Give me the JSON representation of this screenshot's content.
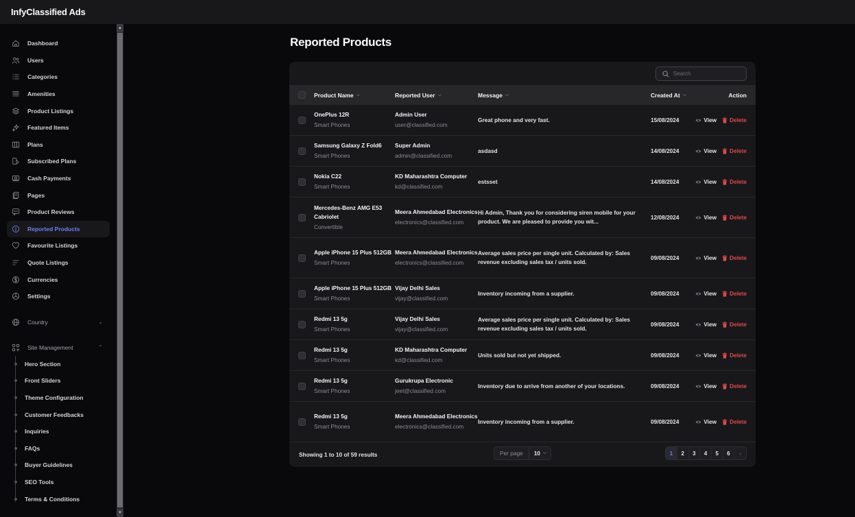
{
  "app": {
    "title": "InfyClassified Ads"
  },
  "sidebar": {
    "items": [
      {
        "label": "Dashboard",
        "icon": "home-icon"
      },
      {
        "label": "Users",
        "icon": "users-icon"
      },
      {
        "label": "Categories",
        "icon": "list-icon"
      },
      {
        "label": "Amenities",
        "icon": "lines-icon"
      },
      {
        "label": "Product Listings",
        "icon": "layers-icon"
      },
      {
        "label": "Featured Items",
        "icon": "sparkles-icon"
      },
      {
        "label": "Plans",
        "icon": "columns-icon"
      },
      {
        "label": "Subscribed Plans",
        "icon": "subscription-icon"
      },
      {
        "label": "Cash Payments",
        "icon": "cash-icon"
      },
      {
        "label": "Pages",
        "icon": "pages-icon"
      },
      {
        "label": "Product Reviews",
        "icon": "chat-icon"
      },
      {
        "label": "Reported Products",
        "icon": "alert-circle-icon",
        "active": true
      },
      {
        "label": "Favourite Listings",
        "icon": "heart-icon"
      },
      {
        "label": "Quote Listings",
        "icon": "quote-lines-icon"
      },
      {
        "label": "Currencies",
        "icon": "dollar-circle-icon"
      },
      {
        "label": "Settings",
        "icon": "settings-icon"
      }
    ],
    "groups": [
      {
        "label": "Country",
        "icon": "globe-icon",
        "expanded": false
      },
      {
        "label": "Site Management",
        "icon": "grid-plus-icon",
        "expanded": true
      }
    ],
    "site_management": [
      "Hero Section",
      "Front Sliders",
      "Theme Configuration",
      "Customer Feedbacks",
      "Inquiries",
      "FAQs",
      "Buyer Guidelines",
      "SEO Tools",
      "Terms & Conditions"
    ]
  },
  "page": {
    "title": "Reported Products",
    "search": {
      "placeholder": "Search",
      "value": ""
    },
    "columns": {
      "product": "Product Name",
      "user": "Reported User",
      "message": "Message",
      "created": "Created At",
      "action": "Action"
    },
    "actions": {
      "view": "View",
      "delete": "Delete"
    },
    "rows": [
      {
        "product": "OnePlus 12R",
        "category": "Smart Phones",
        "user": "Admin User",
        "email": "user@classified.com",
        "message": "Great phone and very fast.",
        "date": "15/08/2024"
      },
      {
        "product": "Samsung Galaxy Z Fold6",
        "category": "Smart Phones",
        "user": "Super Admin",
        "email": "admin@classified.com",
        "message": "asdasd",
        "date": "14/08/2024"
      },
      {
        "product": "Nokia C22",
        "category": "Smart Phones",
        "user": "KD Maharashtra Computer",
        "email": "kd@classified.com",
        "message": "estsset",
        "date": "14/08/2024"
      },
      {
        "product": "Mercedes-Benz AMG E53 Cabriolet",
        "category": "Convertible",
        "user": "Meera Ahmedabad Electronics",
        "email": "electronics@classified.com",
        "message": "Hi Admin, Thank you for considering siren mobile for your product. We are pleased to provide you wit...",
        "date": "12/08/2024"
      },
      {
        "product": "Apple iPhone 15 Plus 512GB",
        "category": "Smart Phones",
        "user": "Meera Ahmedabad Electronics",
        "email": "electronics@classified.com",
        "message": "Average sales price per single unit. Calculated by: Sales revenue excluding sales tax / units sold.",
        "date": "09/08/2024"
      },
      {
        "product": "Apple iPhone 15 Plus 512GB",
        "category": "Smart Phones",
        "user": "Vijay Delhi Sales",
        "email": "vijay@classified.com",
        "message": "Inventory incoming from a supplier.",
        "date": "09/08/2024"
      },
      {
        "product": "Redmi 13 5g",
        "category": "Smart Phones",
        "user": "Vijay Delhi Sales",
        "email": "vijay@classified.com",
        "message": "Average sales price per single unit. Calculated by: Sales revenue excluding sales tax / units sold.",
        "date": "09/08/2024"
      },
      {
        "product": "Redmi 13 5g",
        "category": "Smart Phones",
        "user": "KD Maharashtra Computer",
        "email": "kd@classified.com",
        "message": "Units sold but not yet shipped.",
        "date": "09/08/2024"
      },
      {
        "product": "Redmi 13 5g",
        "category": "Smart Phones",
        "user": "Gurukrupa Electronic",
        "email": "jeet@classified.com",
        "message": "Inventory due to arrive from another of your locations.",
        "date": "09/08/2024"
      },
      {
        "product": "Redmi 13 5g",
        "category": "Smart Phones",
        "user": "Meera Ahmedabad Electronics",
        "email": "electronics@classified.com",
        "message": "Inventory incoming from a supplier.",
        "date": "09/08/2024"
      }
    ],
    "footer": {
      "showing": "Showing 1 to 10 of 59 results",
      "per_page_label": "Per page",
      "per_page_value": "10",
      "pages": [
        "1",
        "2",
        "3",
        "4",
        "5",
        "6"
      ],
      "current_page": "1",
      "next": "›"
    }
  },
  "colors": {
    "accent": "#6e7ef2",
    "danger": "#dc4a4a",
    "background": "#09090b",
    "card": "#18181b"
  }
}
